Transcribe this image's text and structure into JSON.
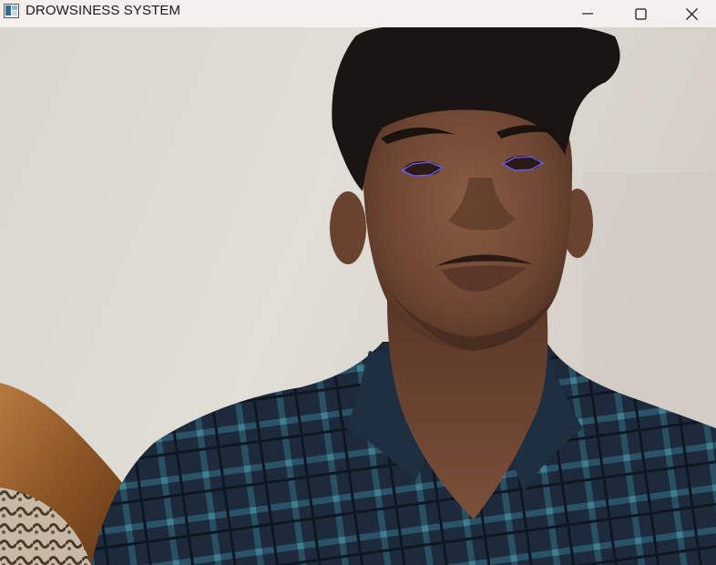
{
  "window": {
    "title": "DROWSINESS SYSTEM",
    "controls": {
      "minimize_icon": "minimize-icon",
      "maximize_icon": "maximize-icon",
      "close_icon": "close-icon"
    }
  },
  "video_feed": {
    "overlay_color": "#6b5cff",
    "eye_contours": [
      "left-eye-contour",
      "right-eye-contour"
    ]
  },
  "colors": {
    "titlebar_bg": "#f5f0ed",
    "wall": "#dcd8d2"
  }
}
